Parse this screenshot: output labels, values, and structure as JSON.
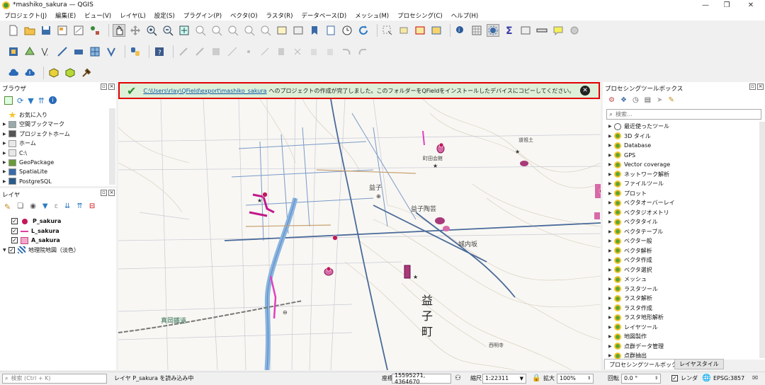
{
  "window": {
    "title": "*mashiko_sakura — QGIS",
    "minimize": "—",
    "maximize": "❐",
    "close": "✕"
  },
  "menu": [
    "プロジェクト(J)",
    "編集(E)",
    "ビュー(V)",
    "レイヤ(L)",
    "設定(S)",
    "プラグイン(P)",
    "ベクタ(O)",
    "ラスタ(R)",
    "データベース(D)",
    "メッシュ(M)",
    "プロセシング(C)",
    "ヘルプ(H)"
  ],
  "message_bar": {
    "path_link": "C:\\Users\\rlay\\QField\\export\\mashiko_sakura",
    "message": "へのプロジェクトの作成が完了しました。このフォルダーをQFieldをインストールしたデバイスにコピーしてください。",
    "close": "✕"
  },
  "browser": {
    "title": "ブラウザ",
    "items": [
      {
        "label": "お気に入り",
        "icon": "star-icon",
        "color": "#f4c430"
      },
      {
        "label": "空間ブックマーク",
        "icon": "bookmark-icon",
        "color": "#9aa"
      },
      {
        "label": "プロジェクトホーム",
        "icon": "project-home-icon",
        "color": "#555"
      },
      {
        "label": "ホーム",
        "icon": "folder-icon",
        "color": "#e8e8e8"
      },
      {
        "label": "C:\\",
        "icon": "drive-icon",
        "color": "#e8e8e8"
      },
      {
        "label": "GeoPackage",
        "icon": "geopackage-icon",
        "color": "#6a9a3a"
      },
      {
        "label": "SpatiaLite",
        "icon": "spatialite-icon",
        "color": "#3a6aa8"
      },
      {
        "label": "PostgreSQL",
        "icon": "postgresql-icon",
        "color": "#2a5a8a"
      }
    ]
  },
  "layers": {
    "title": "レイヤ",
    "items": [
      {
        "label": "P_sakura",
        "icon": "point-symbol-icon",
        "color": "#c2185b",
        "checked": "✓"
      },
      {
        "label": "L_sakura",
        "icon": "line-symbol-icon",
        "color": "#e040a0",
        "checked": "✓"
      },
      {
        "label": "A_sakura",
        "icon": "polygon-symbol-icon",
        "color": "#f2a8c8",
        "checked": "✓"
      },
      {
        "label": "地理院地図（淡色）",
        "icon": "raster-icon",
        "color": "#2b6cb0",
        "checked": "✓"
      }
    ]
  },
  "processing": {
    "title": "プロセシングツールボックス",
    "search_placeholder": "検索...",
    "items": [
      "最近使ったツール",
      "3D タイル",
      "Database",
      "GPS",
      "Vector coverage",
      "ネットワーク解析",
      "ファイルツール",
      "プロット",
      "ベクタオーバーレイ",
      "ベクタジオメトリ",
      "ベクタタイル",
      "ベクタテーブル",
      "ベクター般",
      "ベクタ解析",
      "ベクタ作成",
      "ベクタ選択",
      "メッシュ",
      "ラスタツール",
      "ラスタ解析",
      "ラスタ作成",
      "ラスタ地形解析",
      "レイヤツール",
      "地図製作",
      "点群データ管理",
      "点群抽出"
    ]
  },
  "bottom_tabs": [
    "プロセシングツールボックス",
    "レイヤスタイル"
  ],
  "map": {
    "labels": [
      "益子",
      "益子町",
      "真岡鐵道",
      "城内坂",
      "益子陶芸",
      "西明寺",
      "道祖土",
      "町田会館"
    ],
    "town_chars": [
      "益",
      "子",
      "町"
    ]
  },
  "status": {
    "search_placeholder": "検索 (Ctrl + K)",
    "message": "レイヤ P_sakura を読み込み中",
    "coord_label": "座標",
    "coord_value": "15595271, 4364670",
    "scale_label": "縮尺",
    "scale_value": "1:22311",
    "magnifier_label": "拡大",
    "magnifier_value": "100%",
    "rotation_label": "回転",
    "rotation_value": "0.0 °",
    "render_label": "レンダ",
    "crs": "EPSG:3857"
  }
}
